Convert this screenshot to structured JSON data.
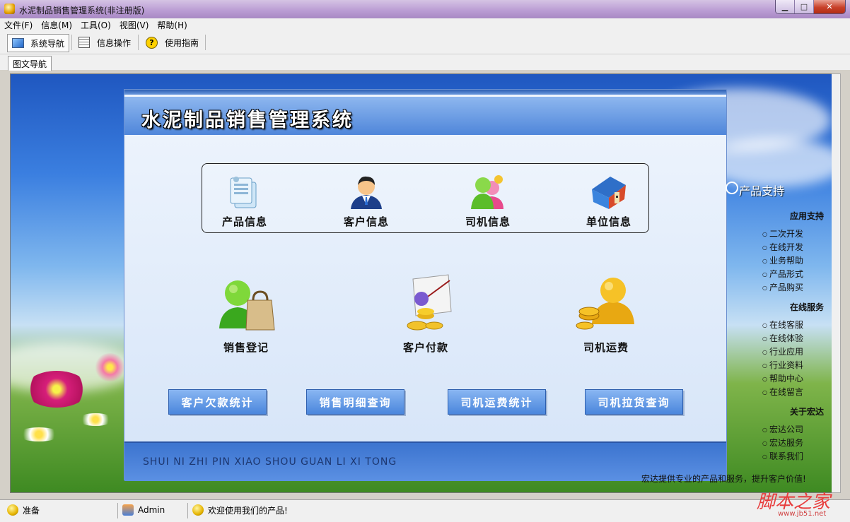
{
  "window": {
    "title": "水泥制品销售管理系统(非注册版)"
  },
  "menubar": [
    "文件(F)",
    "信息(M)",
    "工具(O)",
    "视图(V)",
    "帮助(H)"
  ],
  "toolbar": {
    "nav": "系统导航",
    "ops": "信息操作",
    "guide": "使用指南"
  },
  "tab": {
    "label": "图文导航"
  },
  "panel": {
    "title": "水泥制品销售管理系统",
    "info_items": [
      "产品信息",
      "客户信息",
      "司机信息",
      "单位信息"
    ],
    "main_items": [
      "销售登记",
      "客户付款",
      "司机运费"
    ],
    "query_buttons": [
      "客户欠款统计",
      "销售明细查询",
      "司机运费统计",
      "司机拉货查询"
    ],
    "footer_pinyin": "SHUI NI ZHI PIN XIAO SHOU GUAN LI XI TONG"
  },
  "sidebar": {
    "title": "产品支持",
    "sec1": "应用支持",
    "sec1_items": [
      "二次开发",
      "在线开发",
      "业务帮助",
      "产品形式",
      "产品购买"
    ],
    "sec2": "在线服务",
    "sec2_items": [
      "在线客服",
      "在线体验",
      "行业应用",
      "行业资料",
      "帮助中心",
      "在线留言"
    ],
    "sec3": "关于宏达",
    "sec3_items": [
      "宏达公司",
      "宏达服务",
      "联系我们"
    ]
  },
  "ticker": "宏达提供专业的产品和服务，提升客户价值!",
  "statusbar": {
    "ready": "准备",
    "user": "Admin",
    "welcome": "欢迎使用我们的产品!"
  },
  "watermark": {
    "text": "脚本之家",
    "url": "www.jb51.net"
  }
}
